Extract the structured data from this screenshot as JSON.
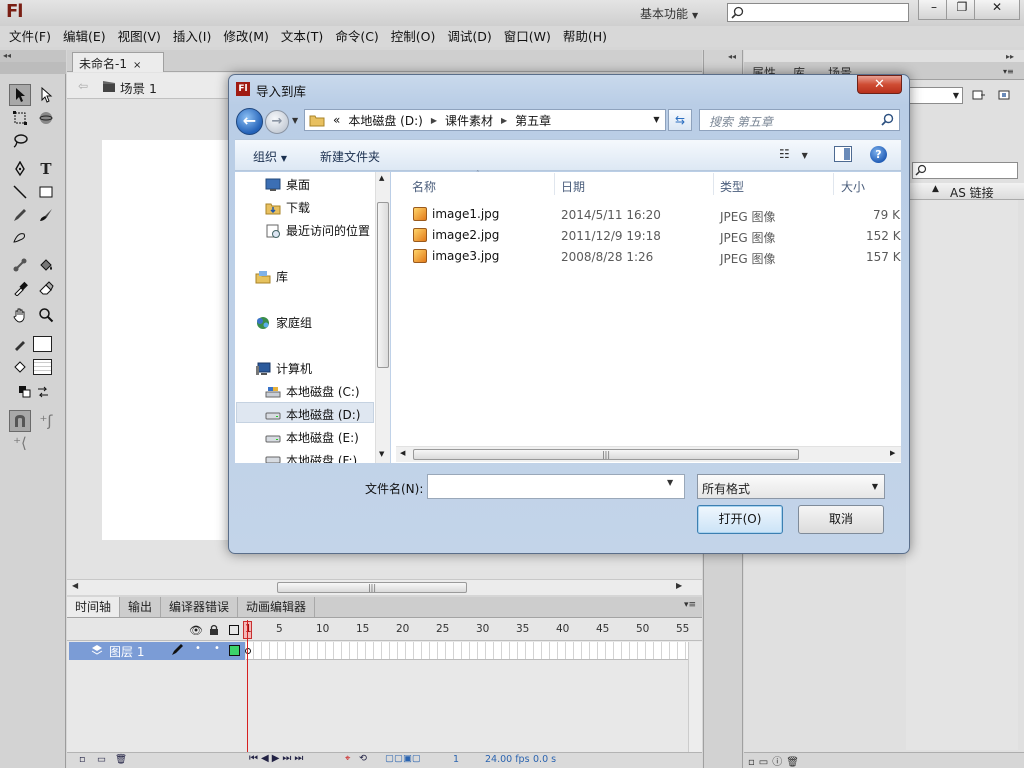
{
  "app": {
    "logo": "Fl",
    "workspace": "基本功能",
    "window_buttons": {
      "minimize": "–",
      "maximize": "❐",
      "close": "✕"
    }
  },
  "menu": [
    "文件(F)",
    "编辑(E)",
    "视图(V)",
    "插入(I)",
    "修改(M)",
    "文本(T)",
    "命令(C)",
    "控制(O)",
    "调试(D)",
    "窗口(W)",
    "帮助(H)"
  ],
  "document": {
    "tab_label": "未命名-1",
    "tab_close": "×",
    "scene": "场景 1"
  },
  "timeline": {
    "tabs": [
      "时间轴",
      "输出",
      "编译器错误",
      "动画编辑器"
    ],
    "layer_name": "图层 1",
    "frame_numbers": [
      "1",
      "5",
      "10",
      "15",
      "20",
      "25",
      "30",
      "35",
      "40",
      "45",
      "50",
      "55"
    ],
    "current_frame": "1",
    "fps": "24.00 fps",
    "time": "0.0 s"
  },
  "right_panel": {
    "tabs": [
      "属性",
      "库",
      "场景"
    ],
    "column_header": "AS 链接"
  },
  "dialog": {
    "title": "导入到库",
    "close": "✕",
    "address": {
      "prefix": "«",
      "segments": [
        "本地磁盘 (D:)",
        "课件素材",
        "第五章"
      ]
    },
    "search_placeholder": "搜索 第五章",
    "toolbar": {
      "organize": "组织",
      "new_folder": "新建文件夹",
      "help": "?"
    },
    "nav_items": [
      {
        "label": "桌面",
        "icon": "desktop-icon"
      },
      {
        "label": "下载",
        "icon": "downloads-icon"
      },
      {
        "label": "最近访问的位置",
        "icon": "recent-places-icon"
      },
      {
        "label": "库",
        "icon": "library-icon"
      },
      {
        "label": "家庭组",
        "icon": "homegroup-icon"
      },
      {
        "label": "计算机",
        "icon": "computer-icon"
      },
      {
        "label": "本地磁盘 (C:)",
        "icon": "drive-icon"
      },
      {
        "label": "本地磁盘 (D:)",
        "icon": "drive-icon",
        "selected": true
      },
      {
        "label": "本地磁盘 (E:)",
        "icon": "drive-icon"
      },
      {
        "label": "本地磁盘 (F:)",
        "icon": "drive-icon"
      }
    ],
    "columns": [
      "名称",
      "日期",
      "类型",
      "大小"
    ],
    "files": [
      {
        "name": "image1.jpg",
        "date": "2014/5/11 16:20",
        "type": "JPEG 图像",
        "size": "79 KB"
      },
      {
        "name": "image2.jpg",
        "date": "2011/12/9 19:18",
        "type": "JPEG 图像",
        "size": "152 KB"
      },
      {
        "name": "image3.jpg",
        "date": "2008/8/28 1:26",
        "type": "JPEG 图像",
        "size": "157 KB"
      }
    ],
    "filename_label": "文件名(N):",
    "filename_value": "",
    "file_type": "所有格式",
    "open_button": "打开(O)",
    "cancel_button": "取消"
  },
  "colors": {
    "accent_blue": "#2462b8",
    "layer_highlight": "#7b9cd6",
    "playhead_red": "#d62020",
    "close_red": "#cf4c33",
    "flash_brand": "#a01b12"
  }
}
